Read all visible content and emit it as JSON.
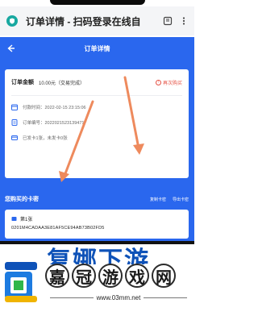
{
  "browser": {
    "title": "订单详情 - 扫码登录在线自",
    "icons": [
      "shield-icon",
      "bookmark-icon",
      "more-icon"
    ]
  },
  "app": {
    "title": "订单详情",
    "order": {
      "amount_label": "订单金额",
      "amount_value": "10.00元（交易完成）",
      "rebuy_label": "再次购买",
      "payment_time": "付款时间：2022-02-15 23:15:06",
      "order_number": "订单编号：20220215231394717",
      "status_note": "已发卡1张，未发卡0张"
    },
    "section": {
      "title": "您购买的卡密",
      "copy_label": "复制卡密",
      "export_label": "导出卡密"
    },
    "card_code": {
      "index_label": "第1张",
      "value": "0201M4CADAA3E81AF5CE94AB73B02FD5"
    }
  },
  "logo": {
    "top_text": "复娜下游",
    "characters": [
      "嘉",
      "冠",
      "游",
      "戏",
      "网"
    ],
    "url": "www.03mm.net"
  },
  "colors": {
    "primary": "#2a67ee",
    "arrow": "#ee8a5d",
    "rebuy": "#e55244",
    "logo_blue": "#0e52b8"
  }
}
